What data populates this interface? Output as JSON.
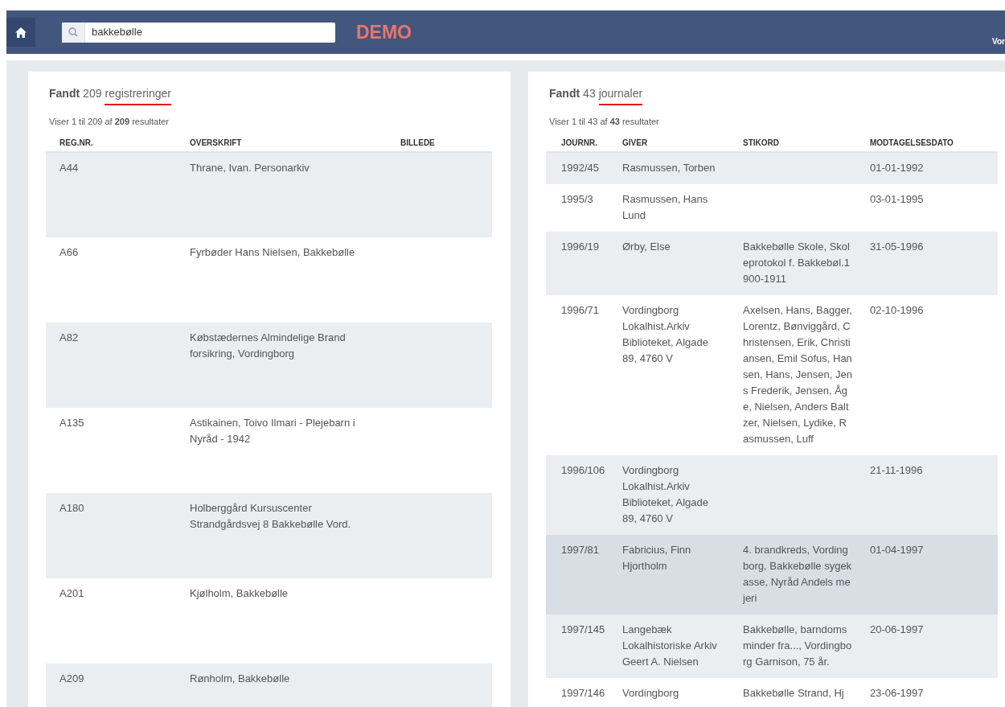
{
  "header": {
    "search": {
      "value": "bakkebølle"
    },
    "badge": "DEMO",
    "user_menu": "Vor"
  },
  "panels": [
    {
      "title": {
        "label": "Fandt",
        "count": "209",
        "noun": "registreringer"
      },
      "summary": "Viser 1 til 209 af **209** resultater",
      "kind": "registrations",
      "columns": [
        "REG.NR.",
        "OVERSKRIFT",
        "BILLEDE"
      ],
      "rows": [
        {
          "cells": [
            "A44",
            "Thrane, Ivan. Personarkiv",
            ""
          ],
          "highlighted": false
        },
        {
          "cells": [
            "A66",
            "Fyrbøder Hans Nielsen, Bakkebølle",
            ""
          ],
          "highlighted": false
        },
        {
          "cells": [
            "A82",
            "Købstædernes Almindelige Brand forsikring, Vordingborg",
            ""
          ],
          "highlighted": false
        },
        {
          "cells": [
            "A135",
            "Astikainen, Toivo Ilmari - Plejebarn i Nyråd - 1942",
            ""
          ],
          "highlighted": false
        },
        {
          "cells": [
            "A180",
            "Holberggård Kursuscenter Strandgårdsvej 8 Bakkebølle Vord.",
            ""
          ],
          "highlighted": false
        },
        {
          "cells": [
            "A201",
            "Kjølholm, Bakkebølle",
            ""
          ],
          "highlighted": false
        },
        {
          "cells": [
            "A209",
            "Rønholm, Bakkebølle",
            ""
          ],
          "highlighted": false
        }
      ]
    },
    {
      "title": {
        "label": "Fandt",
        "count": "43",
        "noun": "journaler"
      },
      "summary": "Viser 1 til 43 af **43** resultater",
      "kind": "journals",
      "columns": [
        "JOURNR.",
        "GIVER",
        "STIKORD",
        "MODTAGELSESDATO"
      ],
      "rows": [
        {
          "cells": [
            "1992/45",
            "Rasmussen, Torben",
            "",
            "01-01-1992"
          ],
          "highlighted": false
        },
        {
          "cells": [
            "1995/3",
            "Rasmussen, Hans Lund",
            "",
            "03-01-1995"
          ],
          "highlighted": false
        },
        {
          "cells": [
            "1996/19",
            "Ørby, Else",
            "Bakkebølle Skole, Skoleprotokol f. Bakkebøl.1900-1911",
            "31-05-1996"
          ],
          "highlighted": false
        },
        {
          "cells": [
            "1996/71",
            "Vordingborg Lokalhist.Arkiv Biblioteket, Algade 89, 4760 V",
            "Axelsen, Hans, Bagger, Lorentz, Bønviggård, Christensen, Erik, Christiansen, Emil Sofus, Hansen, Hans, Jensen, Jens Frederik, Jensen, Åge, Nielsen, Anders Baltzer, Nielsen, Lydike, Rasmussen, Luff",
            "02-10-1996"
          ],
          "highlighted": false
        },
        {
          "cells": [
            "1996/106",
            "Vordingborg Lokalhist.Arkiv Biblioteket, Algade 89, 4760 V",
            "",
            "21-11-1996"
          ],
          "highlighted": false
        },
        {
          "cells": [
            "1997/81",
            "Fabricius, Finn Hjortholm",
            "4. brandkreds, Vordingborg, Bakkebølle sygekasse, Nyråd Andels mejeri",
            "01-04-1997"
          ],
          "highlighted": true
        },
        {
          "cells": [
            "1997/145",
            "Langebæk Lokalhistoriske Arkiv Geert A. Nielsen",
            "Bakkebølle, barndoms minder fra..., Vordingborg Garnison, 75 år.",
            "20-06-1997"
          ],
          "highlighted": false
        },
        {
          "cells": [
            "1997/146",
            "Vordingborg",
            "Bakkebølle Strand, Hj",
            "23-06-1997"
          ],
          "highlighted": false
        }
      ]
    }
  ]
}
